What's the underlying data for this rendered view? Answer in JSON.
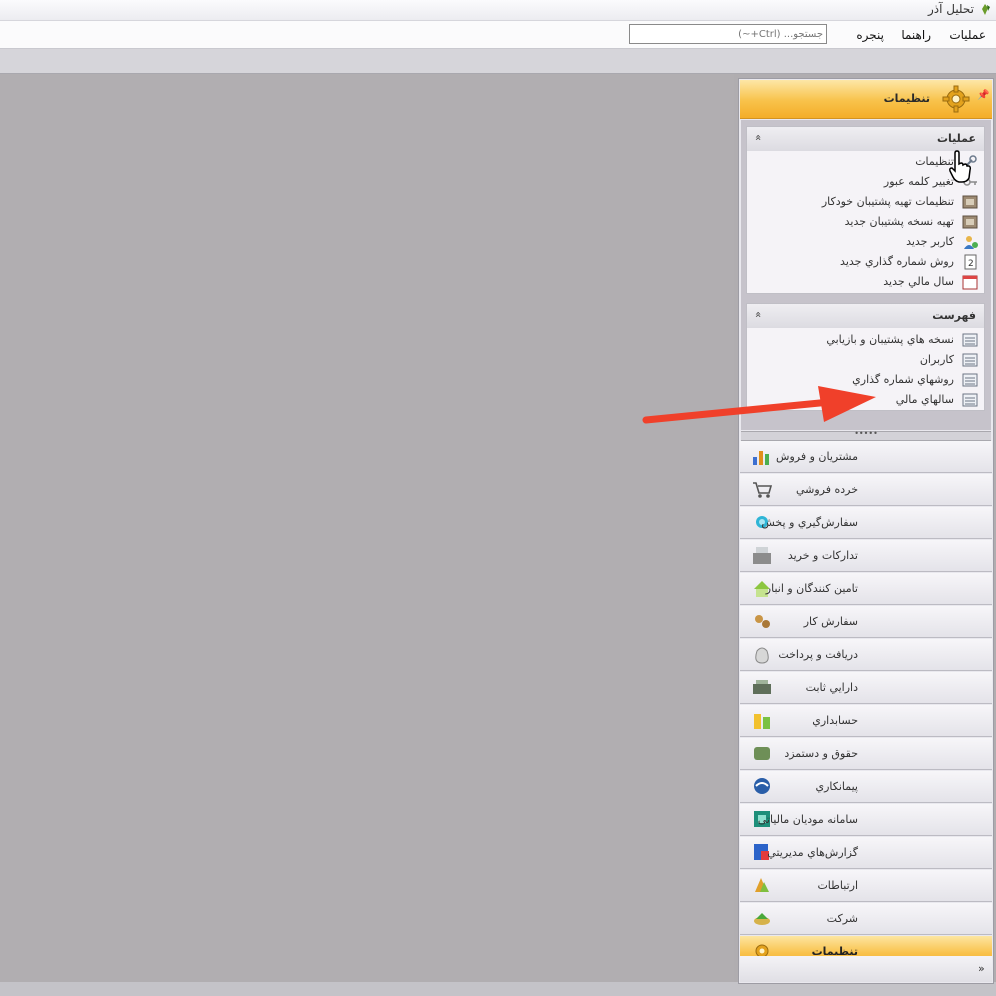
{
  "app": {
    "title": "تحلیل آذر",
    "icon": "app-logo-icon"
  },
  "menu": {
    "items": [
      "عملیات",
      "راهنما",
      "پنجره"
    ]
  },
  "search": {
    "placeholder": "جستجو... (Ctrl+~)"
  },
  "panel": {
    "title": "تنظیمات",
    "icon": "gear-icon",
    "pin_label": "📌",
    "groups": [
      {
        "title": "عملیات",
        "collapse_glyph": "«",
        "items": [
          {
            "label": "تنظیمات",
            "icon": "tools-icon"
          },
          {
            "label": "تغییر کلمه عبور",
            "icon": "key-icon"
          },
          {
            "label": "تنظیمات تهیه پشتیبان خودکار",
            "icon": "backup-settings-icon"
          },
          {
            "label": "تهیه نسخه پشتیبان جدید",
            "icon": "backup-new-icon"
          },
          {
            "label": "کاربر جدید",
            "icon": "add-user-icon"
          },
          {
            "label": "روش شماره گذاري جديد",
            "icon": "numbering-icon"
          },
          {
            "label": "سال مالي جديد",
            "icon": "calendar-icon"
          }
        ]
      },
      {
        "title": "فهرست",
        "collapse_glyph": "«",
        "items": [
          {
            "label": "نسخه هاي پشتيبان و بازيابي",
            "icon": "list-icon"
          },
          {
            "label": "کاربران",
            "icon": "list-icon"
          },
          {
            "label": "روشهاي شماره گذاري",
            "icon": "list-icon"
          },
          {
            "label": "سالهاي مالي",
            "icon": "list-icon"
          }
        ]
      }
    ],
    "splitter_glyph": "•••••",
    "modules": [
      {
        "label": "مشتریان و فروش",
        "icon": "chart-icon",
        "active": false
      },
      {
        "label": "خرده فروشي",
        "icon": "cart-icon",
        "active": false
      },
      {
        "label": "سفارش‌گیري و پخش",
        "icon": "distribution-icon",
        "active": false
      },
      {
        "label": "تدارکات و خرید",
        "icon": "cash-register-icon",
        "active": false
      },
      {
        "label": "تامین کنندگان و انبار",
        "icon": "warehouse-icon",
        "active": false
      },
      {
        "label": "سفارش کار",
        "icon": "work-order-icon",
        "active": false
      },
      {
        "label": "دریافت و پرداخت",
        "icon": "money-bag-icon",
        "active": false
      },
      {
        "label": "دارايي ثابت",
        "icon": "fixed-asset-icon",
        "active": false
      },
      {
        "label": "حسابداري",
        "icon": "accounting-icon",
        "active": false
      },
      {
        "label": "حقوق و دستمزد",
        "icon": "salary-icon",
        "active": false
      },
      {
        "label": "پیمانکاري",
        "icon": "contracting-icon",
        "active": false
      },
      {
        "label": "سامانه مودیان مالیاتی",
        "icon": "tax-system-icon",
        "active": false
      },
      {
        "label": "گزارش‌هاي مديريتي",
        "icon": "report-icon",
        "active": false
      },
      {
        "label": "ارتباطات",
        "icon": "communication-icon",
        "active": false
      },
      {
        "label": "شرکت",
        "icon": "company-icon",
        "active": false
      },
      {
        "label": "تنظیمات",
        "icon": "gear-icon",
        "active": true
      }
    ],
    "footer_glyph": "»"
  },
  "colors": {
    "accent": "#f8c24a",
    "arrow": "#f0402a",
    "workspace": "#b1aeb1"
  }
}
